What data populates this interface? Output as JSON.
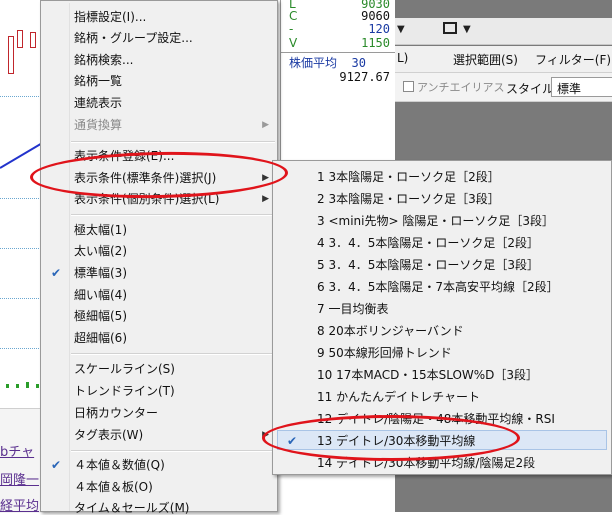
{
  "quote": {
    "rows": [
      {
        "label": "L",
        "value": "9030"
      },
      {
        "label": "C",
        "value": "9060"
      },
      {
        "label": "-",
        "value": "120"
      },
      {
        "label": "V",
        "value": "1150"
      }
    ],
    "ma_label": "株価平均",
    "ma_period": "30",
    "ma_value": "9127.67"
  },
  "app_menu": {
    "filter_short": "L)",
    "select_range": "選択範囲(S)",
    "filter": "フィルター(F)",
    "antialias": "アンチエイリアス",
    "style_label": "スタイル:",
    "style_value": "標準"
  },
  "background_links": [
    "bチャ",
    "岡隆一",
    "経平均"
  ],
  "context_menu": {
    "g1": [
      "指標設定(I)...",
      "銘柄・グループ設定...",
      "銘柄検索...",
      "銘柄一覧",
      "連続表示",
      "通貨換算"
    ],
    "g2": [
      "表示条件登録(E)...",
      "表示条件(標準条件)選択(J)",
      "表示条件(個別条件)選択(L)"
    ],
    "g3": [
      "極太幅(1)",
      "太い幅(2)",
      "標準幅(3)",
      "細い幅(4)",
      "極細幅(5)",
      "超細幅(6)"
    ],
    "g4": [
      "スケールライン(S)",
      "トレンドライン(T)",
      "日柄カウンター",
      "タグ表示(W)"
    ],
    "g5": [
      "４本値＆数値(Q)",
      "４本値＆板(O)",
      "タイム＆セールズ(M)"
    ]
  },
  "submenu": [
    "1 3本陰陽足・ローソク足［2段］",
    "2 3本陰陽足・ローソク足［3段］",
    "3 <mini先物> 陰陽足・ローソク足［3段］",
    "4 3．4．5本陰陽足・ローソク足［2段］",
    "5 3．4．5本陰陽足・ローソク足［3段］",
    "6 3．4．5本陰陽足・7本高安平均線［2段］",
    "7 一目均衡表",
    "8 20本ボリンジャーバンド",
    "9 50本線形回帰トレンド",
    "10 17本MACD・15本SLOW%D［3段］",
    "11 かんたんデイトレチャート",
    "12 デイトレ/陰陽足・48本移動平均線・RSI",
    "13 デイトレ/30本移動平均線",
    "14 デイトレ/30本移動平均線/陰陽足2段"
  ],
  "colors": {
    "highlight": "#dce7f6",
    "annotation": "#e0141b",
    "check": "#2a66b8"
  }
}
